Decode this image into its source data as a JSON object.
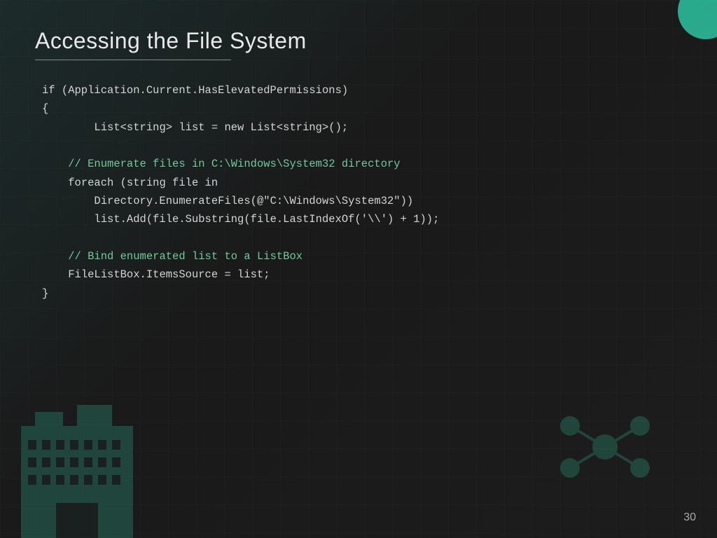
{
  "slide": {
    "title": "Accessing the File System",
    "slide_number": "30",
    "code": {
      "line1": "if (Application.Current.HasElevatedPermissions)",
      "line2": "{",
      "line3": "    List<string> list = new List<string>();",
      "line4": "",
      "line5": "    // Enumerate files in C:\\Windows\\System32 directory",
      "line6": "    foreach (string file in",
      "line7": "        Directory.EnumerateFiles(@\"C:\\Windows\\System32\"))",
      "line8": "        list.Add(file.Substring(file.LastIndexOf('\\\\') + 1));",
      "line9": "",
      "line10": "    // Bind enumerated list to a ListBox",
      "line11": "    FileListBox.ItemsSource = list;",
      "line12": "}"
    }
  },
  "colors": {
    "background": "#1a1a1a",
    "title": "#e8e8e8",
    "code_text": "#d4d4d4",
    "code_comment": "#6fcb9a",
    "accent": "#2ec4a0",
    "divider": "#888888"
  }
}
